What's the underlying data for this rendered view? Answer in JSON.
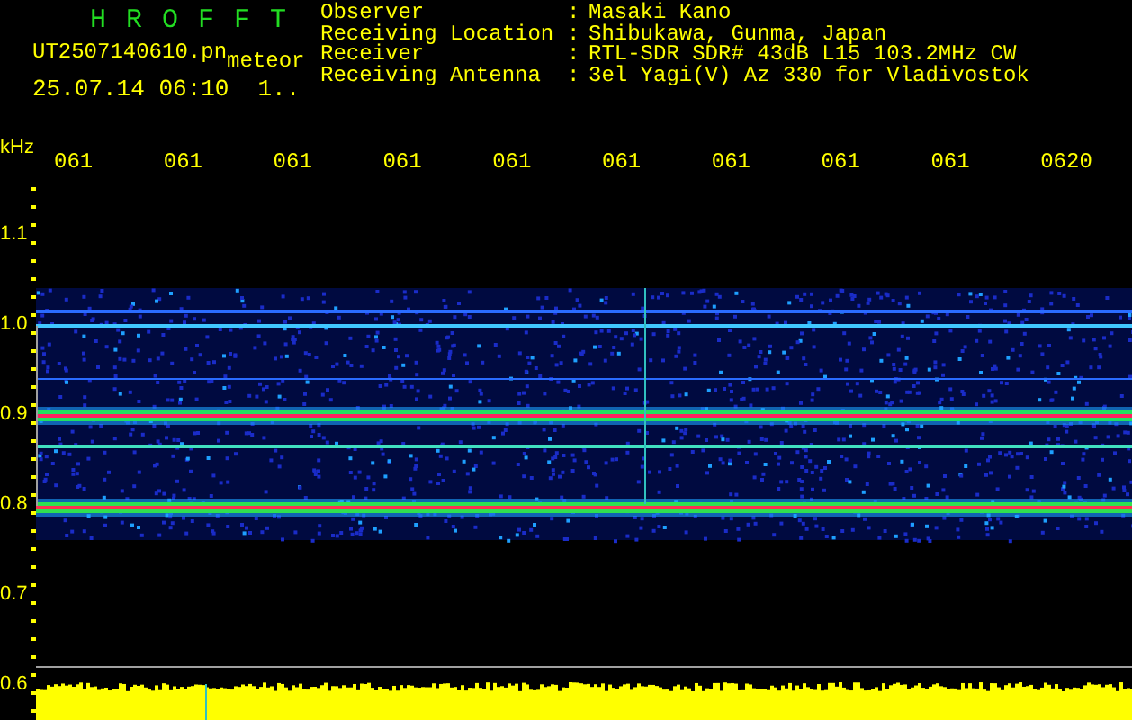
{
  "header": {
    "app_title": "HROFFT",
    "file_name": "UT2507140610.pn",
    "mode": "meteor",
    "timestamp": "25.07.14 06:10",
    "counter": "1.."
  },
  "station_info": [
    {
      "label": "Observer",
      "separator": ":",
      "value": "Masaki Kano"
    },
    {
      "label": "Receiving Location",
      "separator": ":",
      "value": "Shibukawa, Gunma, Japan"
    },
    {
      "label": "Receiver",
      "separator": ":",
      "value": "RTL-SDR SDR# 43dB L15 103.2MHz CW"
    },
    {
      "label": "Receiving Antenna",
      "separator": ":",
      "value": "3el Yagi(V) Az 330 for Vladivostok"
    }
  ],
  "frequency_axis": {
    "unit": "kHz",
    "labels": [
      "1.1",
      "1.0",
      "0.9",
      "0.8",
      "0.7",
      "0.6"
    ]
  },
  "time_axis": {
    "labels": [
      "061",
      "061",
      "061",
      "061",
      "061",
      "061",
      "061",
      "061",
      "061",
      "0620"
    ]
  }
}
